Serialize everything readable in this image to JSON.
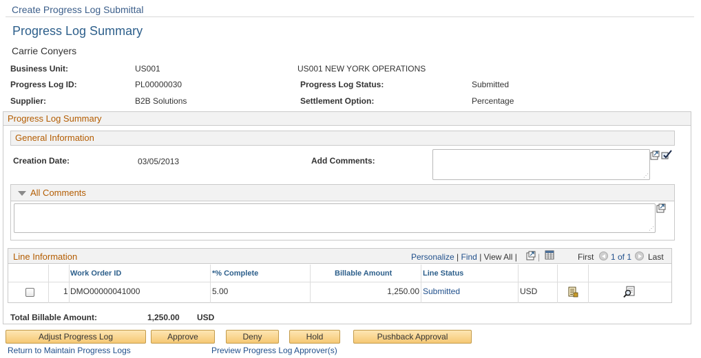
{
  "page": {
    "breadcrumb_title": "Create Progress Log Submittal",
    "heading": "Progress Log Summary",
    "person_name": "Carrie Conyers"
  },
  "header_fields": {
    "business_unit_label": "Business Unit:",
    "business_unit_value": "US001",
    "business_unit_desc": "US001 NEW YORK OPERATIONS",
    "progress_log_id_label": "Progress Log ID:",
    "progress_log_id_value": "PL00000030",
    "progress_log_status_label": "Progress Log Status:",
    "progress_log_status_value": "Submitted",
    "supplier_label": "Supplier:",
    "supplier_value": "B2B Solutions",
    "settlement_option_label": "Settlement Option:",
    "settlement_option_value": "Percentage"
  },
  "summary_section": {
    "title": "Progress Log Summary",
    "general_info_title": "General Information",
    "creation_date_label": "Creation Date:",
    "creation_date_value": "03/05/2013",
    "add_comments_label": "Add Comments:",
    "add_comments_value": "",
    "all_comments_title": "All Comments",
    "all_comments_value": ""
  },
  "line_grid": {
    "title": "Line Information",
    "personalize": "Personalize",
    "find": "Find",
    "view_all": "View All",
    "first": "First",
    "pager": "1 of 1",
    "last": "Last",
    "columns": {
      "work_order_id": "Work Order ID",
      "pct_complete": "*% Complete",
      "billable_amount": "Billable Amount",
      "line_status": "Line Status"
    },
    "rows": [
      {
        "line_no": "1",
        "work_order_id": "DMO00000041000",
        "pct_complete": "5.00",
        "billable_amount": "1,250.00",
        "line_status": "Submitted",
        "currency": "USD"
      }
    ]
  },
  "totals": {
    "label": "Total Billable Amount:",
    "value": "1,250.00",
    "currency": "USD"
  },
  "buttons": {
    "adjust": "Adjust Progress Log",
    "approve": "Approve",
    "deny": "Deny",
    "hold": "Hold",
    "pushback": "Pushback Approval"
  },
  "links": {
    "return": "Return to Maintain Progress Logs",
    "preview": "Preview Progress Log Approver(s)"
  },
  "colors": {
    "accent_orange": "#b35c00",
    "link_blue": "#1f4f8b",
    "button_gold": "#f6c874"
  }
}
